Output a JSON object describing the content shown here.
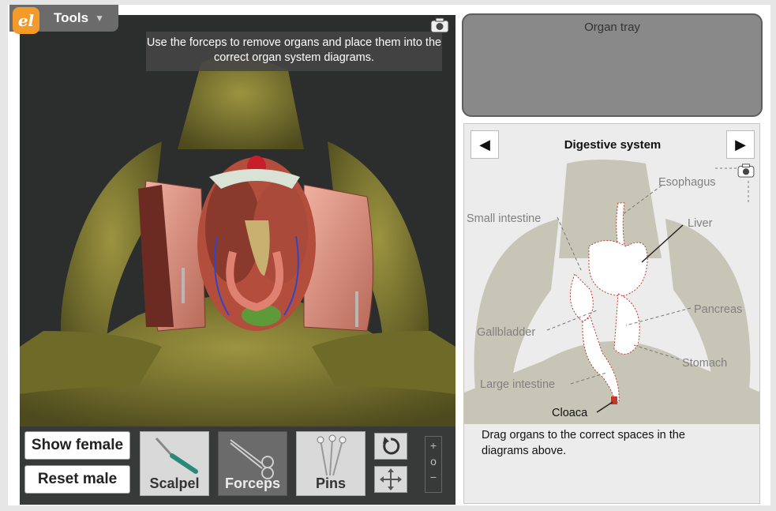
{
  "tools": {
    "logo_text": "el",
    "label": "Tools",
    "caret": "▼"
  },
  "viewport": {
    "instruction": "Use the forceps to remove organs and place them into the correct organ system diagrams.",
    "camera_icon": "camera-icon"
  },
  "toolbar": {
    "show_female": "Show female",
    "reset_male": "Reset male",
    "tools": [
      {
        "label": "Scalpel",
        "icon": "scalpel-icon",
        "active": false
      },
      {
        "label": "Forceps",
        "icon": "forceps-icon",
        "active": true
      },
      {
        "label": "Pins",
        "icon": "pins-icon",
        "active": false
      }
    ],
    "rotate_icon": "rotate-icon",
    "move_icon": "move-icon",
    "zoom": {
      "plus": "+",
      "reset": "o",
      "minus": "−"
    }
  },
  "tray": {
    "title": "Organ tray"
  },
  "diagram": {
    "title": "Digestive system",
    "prev": "◀",
    "next": "▶",
    "labels": {
      "esophagus": "Esophagus",
      "small_intestine": "Small intestine",
      "liver": "Liver",
      "pancreas": "Pancreas",
      "gallbladder": "Gallbladder",
      "stomach": "Stomach",
      "large_intestine": "Large intestine",
      "cloaca": "Cloaca"
    },
    "note": "Drag organs to the correct spaces in the diagrams above."
  },
  "colors": {
    "accent_logo": "#f39a2a",
    "frog_skin": "#7a7430",
    "organ_outline": "#c0392b"
  }
}
